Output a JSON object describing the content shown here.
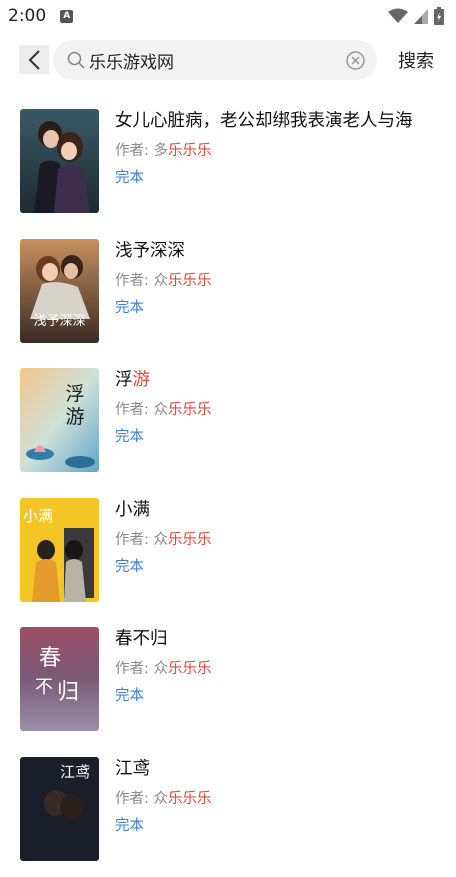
{
  "status_bar": {
    "time": "2:00",
    "a_icon_label": "A"
  },
  "search": {
    "query": "乐乐游戏网",
    "button_label": "搜索"
  },
  "books": [
    {
      "title_pre": "女儿心脏病，老公却绑我表演老人与海",
      "title_hl": "",
      "title_post": "",
      "author_prefix": "作者: 多",
      "author_hl": "乐乐乐",
      "status": "完本",
      "cover_text": ""
    },
    {
      "title_pre": "浅予深深",
      "title_hl": "",
      "title_post": "",
      "author_prefix": "作者: 众",
      "author_hl": "乐乐乐",
      "status": "完本",
      "cover_text": "浅予深深"
    },
    {
      "title_pre": "浮",
      "title_hl": "游",
      "title_post": "",
      "author_prefix": "作者: 众",
      "author_hl": "乐乐乐",
      "status": "完本",
      "cover_text": "浮游"
    },
    {
      "title_pre": "小满",
      "title_hl": "",
      "title_post": "",
      "author_prefix": "作者: 众",
      "author_hl": "乐乐乐",
      "status": "完本",
      "cover_text": "小满"
    },
    {
      "title_pre": "春不归",
      "title_hl": "",
      "title_post": "",
      "author_prefix": "作者: 众",
      "author_hl": "乐乐乐",
      "status": "完本",
      "cover_text": "春不归"
    },
    {
      "title_pre": "江鸢",
      "title_hl": "",
      "title_post": "",
      "author_prefix": "作者: 众",
      "author_hl": "乐乐乐",
      "status": "完本",
      "cover_text": "江鸢"
    }
  ],
  "colors": {
    "highlight": "#e0483b",
    "status_blue": "#3b7fd0",
    "author_gray": "#8a8a8a"
  }
}
